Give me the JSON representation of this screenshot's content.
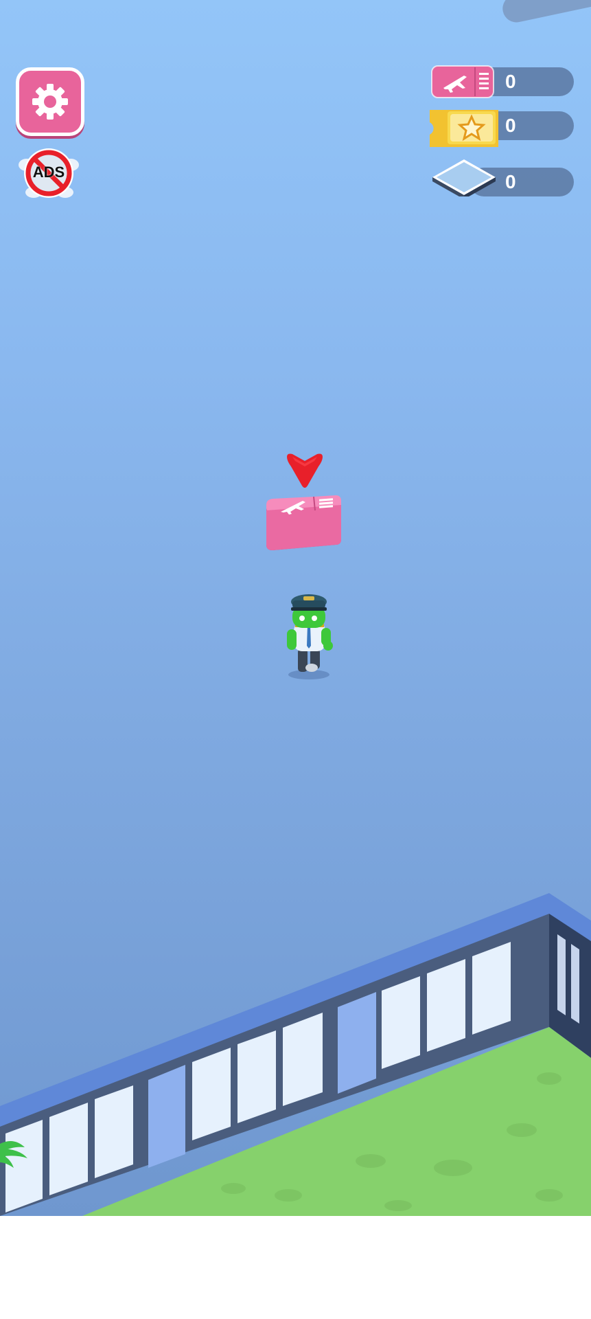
{
  "hud": {
    "tickets": {
      "icon": "plane-ticket-icon",
      "value": "0"
    },
    "vip_tickets": {
      "icon": "star-ticket-icon",
      "value": "0"
    },
    "floor_tiles": {
      "icon": "floor-tile-icon",
      "value": "0"
    }
  },
  "buttons": {
    "settings": {
      "icon": "gear-icon"
    },
    "no_ads": {
      "icon": "no-ads-icon",
      "label": "ADS"
    }
  },
  "world": {
    "pickup_item": "plane-ticket",
    "pickup_marker": "down-arrow-icon",
    "player": "pilot-character"
  },
  "colors": {
    "accent_pink": "#e8649b",
    "gold": "#f2c230",
    "marker_red": "#e8202a",
    "sky_blue": "#8ab8ef",
    "grass": "#86d16c",
    "hud_bar": "#5f7ea8"
  }
}
